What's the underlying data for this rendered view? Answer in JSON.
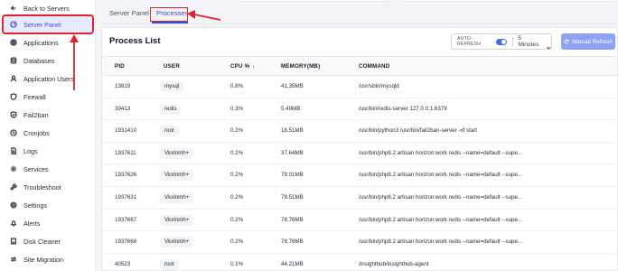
{
  "sidebar": {
    "items": [
      {
        "label": "Back to Servers",
        "icon": "arrow-left-icon"
      },
      {
        "label": "Server Panel",
        "icon": "gauge-icon",
        "active": true
      },
      {
        "label": "Applications",
        "icon": "globe-icon"
      },
      {
        "label": "Databases",
        "icon": "database-icon"
      },
      {
        "label": "Application Users",
        "icon": "user-icon"
      },
      {
        "label": "Firewall",
        "icon": "shield-icon"
      },
      {
        "label": "Fail2ban",
        "icon": "shield-check-icon"
      },
      {
        "label": "Cronjobs",
        "icon": "clock-icon"
      },
      {
        "label": "Logs",
        "icon": "file-icon"
      },
      {
        "label": "Services",
        "icon": "gear-icon"
      },
      {
        "label": "Troubleshoot",
        "icon": "wrench-icon"
      },
      {
        "label": "Settings",
        "icon": "settings-icon"
      },
      {
        "label": "Alerts",
        "icon": "bell-icon"
      },
      {
        "label": "Disk Cleaner",
        "icon": "disk-icon"
      },
      {
        "label": "Site Migration",
        "icon": "migrate-icon"
      }
    ]
  },
  "tabs": [
    {
      "label": "Server Panel"
    },
    {
      "label": "Processes",
      "active": true
    }
  ],
  "panel": {
    "title": "Process List",
    "auto_refresh_label": "AUTO-REFRESH",
    "auto_refresh_on": true,
    "interval": "5 Minutes",
    "manual_refresh_label": "Manual Refresh"
  },
  "table": {
    "columns": [
      "PID",
      "USER",
      "CPU %",
      "MEMORY(MB)",
      "COMMAND"
    ],
    "rows": [
      {
        "pid": "13819",
        "user": "mysql",
        "cpu": "0.8%",
        "memory": "41.35MB",
        "command": "/usr/sbin/mysqld"
      },
      {
        "pid": "39413",
        "user": "redis",
        "cpu": "0.3%",
        "memory": "5.49MB",
        "command": "/usr/bin/redis-server 127.0.0.1:6379"
      },
      {
        "pid": "1931410",
        "user": "root",
        "cpu": "0.2%",
        "memory": "18.51MB",
        "command": "/usr/bin/python3 /usr/bin/fail2ban-server -xf start"
      },
      {
        "pid": "1937611",
        "user": "Vkxlnmh+",
        "cpu": "0.2%",
        "memory": "37.64MB",
        "command": "/usr/bin/php8.2 artisan horizon:work redis --name=default --supe..."
      },
      {
        "pid": "1937626",
        "user": "Vkxlnmh+",
        "cpu": "0.2%",
        "memory": "79.01MB",
        "command": "/usr/bin/php8.2 artisan horizon:work redis --name=default --supe..."
      },
      {
        "pid": "1937631",
        "user": "Vkxlnmh+",
        "cpu": "0.2%",
        "memory": "78.51MB",
        "command": "/usr/bin/php8.2 artisan horizon:work redis --name=default --supe..."
      },
      {
        "pid": "1937667",
        "user": "Vkxlnmh+",
        "cpu": "0.2%",
        "memory": "78.76MB",
        "command": "/usr/bin/php8.2 artisan horizon:work redis --name=default --supe..."
      },
      {
        "pid": "1937668",
        "user": "Vkxlnmh+",
        "cpu": "0.2%",
        "memory": "78.76MB",
        "command": "/usr/bin/php8.2 artisan horizon:work redis --name=default --supe..."
      },
      {
        "pid": "40523",
        "user": "root",
        "cpu": "0.1%",
        "memory": "44.21MB",
        "command": "/insighthub/insighthub-agent"
      }
    ]
  },
  "colors": {
    "accent": "#3b4dd6",
    "annotation": "#e0242b",
    "button": "#8da2f2"
  }
}
